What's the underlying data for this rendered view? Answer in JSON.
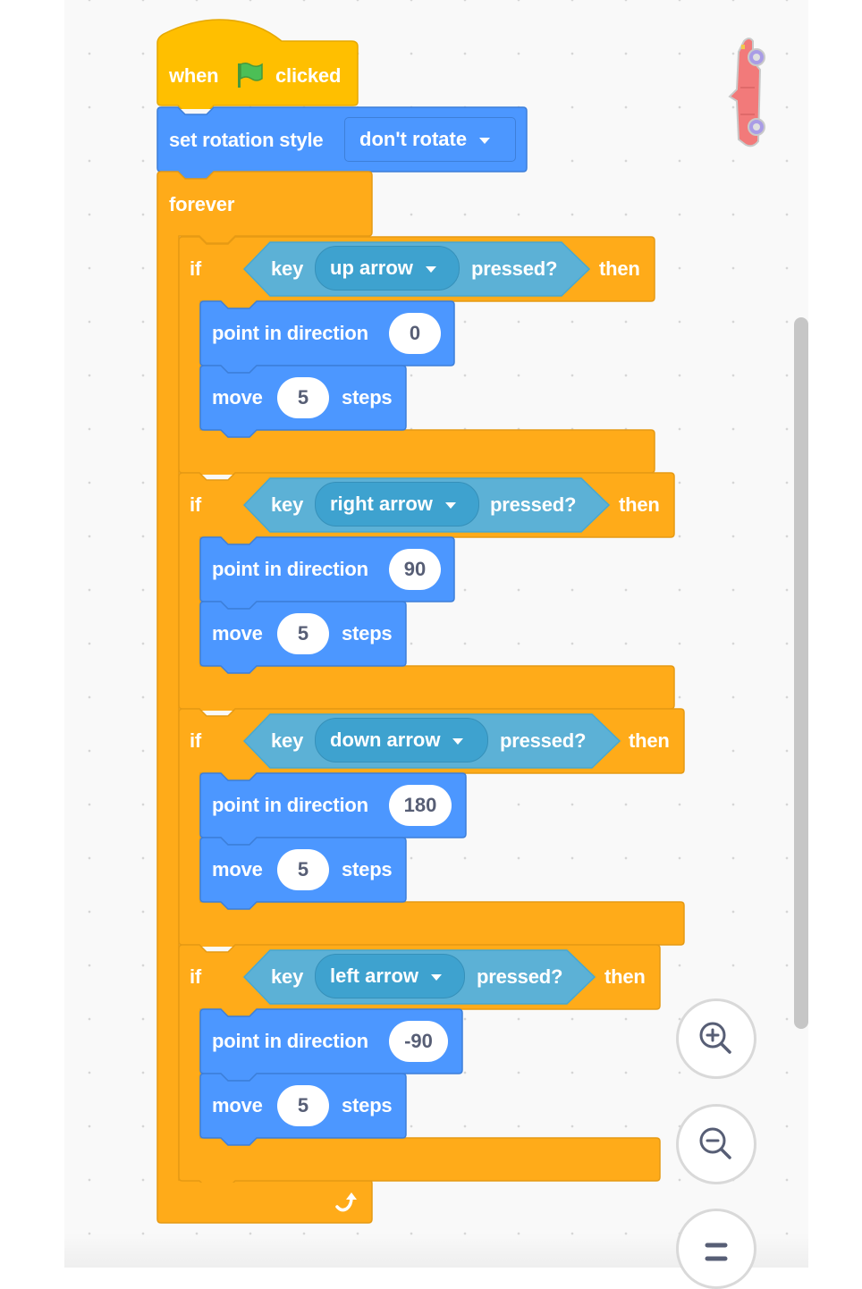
{
  "workspace": {
    "background": "#f9f9f9",
    "sprite": {
      "name": "red convertible car",
      "rotation": "pointing up"
    }
  },
  "colors": {
    "events": "#ffbf00",
    "motion": "#4c97ff",
    "control": "#ffab19",
    "sensing": "#5cb1d6",
    "flag": "#4cbf56"
  },
  "script": {
    "hat": {
      "when_label": "when",
      "icon": "green-flag-icon",
      "clicked_label": "clicked"
    },
    "rotation": {
      "label": "set rotation style",
      "value": "don't rotate"
    },
    "forever": {
      "label": "forever",
      "icon": "loop-arrow-icon"
    },
    "ifs": [
      {
        "if_label": "if",
        "key_label": "key",
        "key": "up arrow",
        "pressed_label": "pressed?",
        "then_label": "then",
        "point_label": "point in direction",
        "direction": "0",
        "move_label": "move",
        "steps": "5",
        "steps_label": "steps"
      },
      {
        "if_label": "if",
        "key_label": "key",
        "key": "right arrow",
        "pressed_label": "pressed?",
        "then_label": "then",
        "point_label": "point in direction",
        "direction": "90",
        "move_label": "move",
        "steps": "5",
        "steps_label": "steps"
      },
      {
        "if_label": "if",
        "key_label": "key",
        "key": "down arrow",
        "pressed_label": "pressed?",
        "then_label": "then",
        "point_label": "point in direction",
        "direction": "180",
        "move_label": "move",
        "steps": "5",
        "steps_label": "steps"
      },
      {
        "if_label": "if",
        "key_label": "key",
        "key": "left arrow",
        "pressed_label": "pressed?",
        "then_label": "then",
        "point_label": "point in direction",
        "direction": "-90",
        "move_label": "move",
        "steps": "5",
        "steps_label": "steps"
      }
    ]
  },
  "zoom_controls": [
    {
      "name": "zoom-in",
      "icon": "zoom-in-icon"
    },
    {
      "name": "zoom-out",
      "icon": "zoom-out-icon"
    },
    {
      "name": "zoom-reset",
      "icon": "equals-icon"
    }
  ]
}
